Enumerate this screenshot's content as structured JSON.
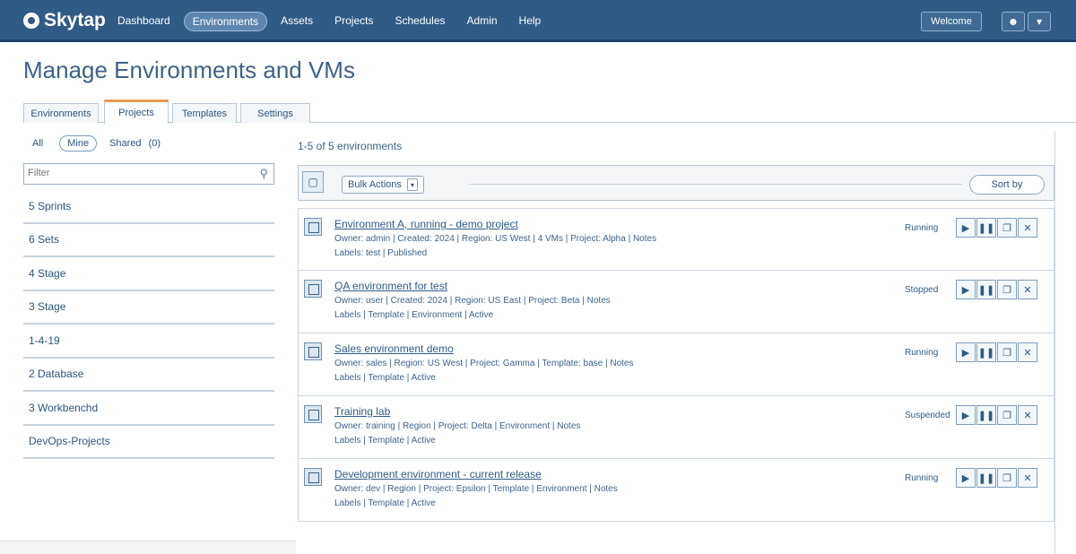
{
  "app": {
    "logo_text": "Skytap",
    "nav": [
      {
        "label": "Dashboard",
        "active": false
      },
      {
        "label": "Environments",
        "active": true
      },
      {
        "label": "Assets",
        "active": false
      },
      {
        "label": "Projects",
        "active": false
      },
      {
        "label": "Schedules",
        "active": false
      },
      {
        "label": "Admin",
        "active": false
      },
      {
        "label": "Help",
        "active": false
      }
    ],
    "user_label": "Welcome",
    "icons": {
      "user": "user-icon",
      "menu": "chevron-down-icon"
    }
  },
  "page": {
    "title": "Manage Environments and VMs"
  },
  "tabs": [
    {
      "label": "Environments",
      "active": false
    },
    {
      "label": "Projects",
      "active": true
    },
    {
      "label": "Templates",
      "active": false
    },
    {
      "label": "Settings",
      "active": false
    }
  ],
  "sidebar": {
    "filters": {
      "all": "All",
      "active": "Mine",
      "shared": "Shared",
      "count": "(0)"
    },
    "search_placeholder": "Filter",
    "items": [
      {
        "label": "5 Sprints"
      },
      {
        "label": "6 Sets"
      },
      {
        "label": "4 Stage"
      },
      {
        "label": "3 Stage"
      },
      {
        "label": "1-4-19"
      },
      {
        "label": "2 Database"
      },
      {
        "label": "3 Workbenchd"
      },
      {
        "label": "DevOps-Projects"
      }
    ]
  },
  "content": {
    "result_count": "1-5 of 5 environments",
    "toolbar": {
      "bulk_action": "Bulk Actions",
      "sort": "Sort by"
    },
    "environments": [
      {
        "title": "Environment A, running - demo project",
        "meta1": "Owner: admin | Created: 2024 | Region: US West | 4 VMs | Project: Alpha | Notes",
        "meta2": "Labels: test | Published",
        "status": "Running"
      },
      {
        "title": "QA environment for test",
        "meta1": "Owner: user | Created: 2024 | Region: US East | Project: Beta | Notes",
        "meta2": "Labels | Template | Environment | Active",
        "status": "Stopped"
      },
      {
        "title": "Sales environment demo",
        "meta1": "Owner: sales | Region: US West | Project: Gamma | Template: base | Notes",
        "meta2": "Labels | Template | Active",
        "status": "Running"
      },
      {
        "title": "Training lab",
        "meta1": "Owner: training | Region | Project: Delta | Environment | Notes",
        "meta2": "Labels | Template | Active",
        "status": "Suspended"
      },
      {
        "title": "Development environment - current release",
        "meta1": "Owner: dev | Region | Project: Epsilon | Template | Environment | Notes",
        "meta2": "Labels | Template | Active",
        "status": "Running"
      }
    ],
    "action_icons": [
      "play-icon",
      "pause-icon",
      "copy-icon",
      "delete-icon"
    ]
  }
}
